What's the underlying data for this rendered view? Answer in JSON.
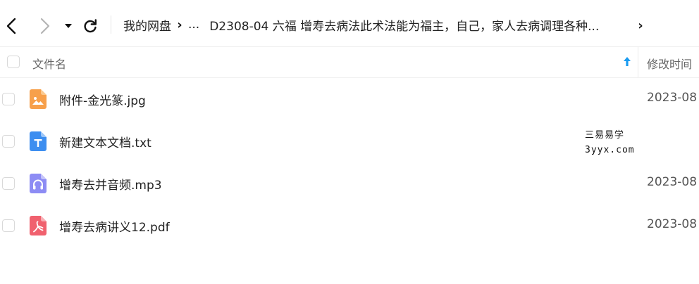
{
  "toolbar": {
    "breadcrumb": {
      "root": "我的网盘",
      "ellipsis": "...",
      "current": "D2308-04 六福  增寿去病法此术法能为福主，自己，家人去病调理各种..."
    }
  },
  "table": {
    "headers": {
      "name": "文件名",
      "time": "修改时间"
    },
    "rows": [
      {
        "name": "附件-金光篆.jpg",
        "time": "2023-08",
        "icon": "image-file-icon",
        "color": "#f7a04b"
      },
      {
        "name": "新建文本文档.txt",
        "time": "",
        "icon": "text-file-icon",
        "color": "#3d8ef0"
      },
      {
        "name": "增寿去并音频.mp3",
        "time": "2023-08",
        "icon": "audio-file-icon",
        "color": "#8d8cf4"
      },
      {
        "name": "增寿去病讲义12.pdf",
        "time": "2023-08",
        "icon": "pdf-file-icon",
        "color": "#f0616e"
      }
    ]
  },
  "watermark": {
    "line1": "三易易学",
    "line2": "3yyx.com"
  },
  "colors": {
    "accent": "#1a9bf0",
    "divider": "#eeeeee"
  }
}
